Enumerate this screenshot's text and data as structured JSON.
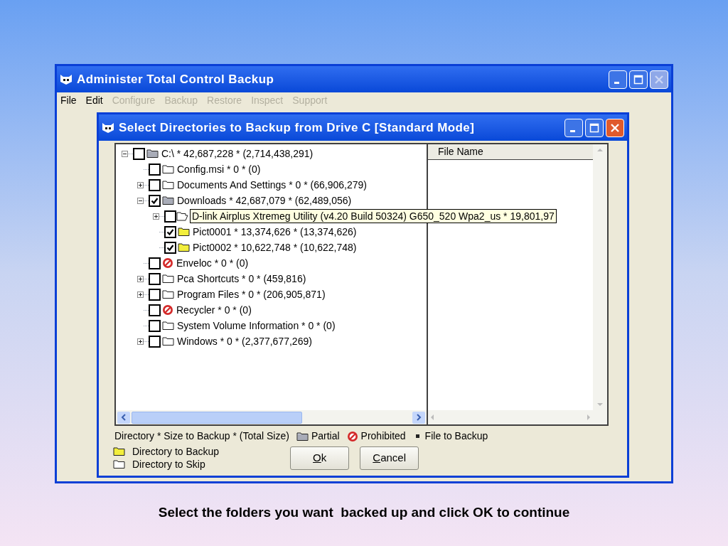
{
  "slide": {
    "caption": "Select the folders you want  backed up and click OK to continue"
  },
  "window": {
    "title": "Administer Total Control Backup",
    "controls": [
      {
        "kind": "minimize",
        "disabled": false
      },
      {
        "kind": "maximize",
        "disabled": false
      },
      {
        "kind": "close",
        "disabled": true
      }
    ]
  },
  "menu": [
    {
      "label": "File",
      "disabled": false
    },
    {
      "label": "Edit",
      "disabled": false
    },
    {
      "label": "Configure",
      "disabled": true
    },
    {
      "label": "Backup",
      "disabled": true
    },
    {
      "label": "Restore",
      "disabled": true
    },
    {
      "label": "Inspect",
      "disabled": true
    },
    {
      "label": "Support",
      "disabled": true
    }
  ],
  "dialog": {
    "title": "Select Directories to Backup from Drive C [Standard Mode]",
    "controls": [
      {
        "kind": "minimize",
        "disabled": false
      },
      {
        "kind": "maximize",
        "disabled": false
      },
      {
        "kind": "close",
        "disabled": false
      }
    ],
    "tree": [
      {
        "label": "C:\\ * 42,687,228 * (2,714,438,291)",
        "checked": false,
        "kind": "partial",
        "expanded": true,
        "hovered": false,
        "children": [
          {
            "label": "Config.msi * 0 * (0)",
            "checked": false,
            "kind": "skip",
            "hovered": false
          },
          {
            "label": "Documents And Settings * 0 * (66,906,279)",
            "checked": false,
            "kind": "skip",
            "expanded": false,
            "hovered": false
          },
          {
            "label": "Downloads * 42,687,079 * (62,489,056)",
            "checked": true,
            "kind": "partial",
            "expanded": true,
            "hovered": false,
            "children": [
              {
                "label": "D-link Airplus Xtremeg Utility (v4.20 Build 50324) G650_520 Wpa2_us * 19,801,97",
                "checked": false,
                "kind": "open",
                "expanded": false,
                "hovered": true
              },
              {
                "label": "Pict0001 * 13,374,626 * (13,374,626)",
                "checked": true,
                "kind": "backup",
                "hovered": false
              },
              {
                "label": "Pict0002 * 10,622,748 * (10,622,748)",
                "checked": true,
                "kind": "backup",
                "hovered": false
              }
            ]
          },
          {
            "label": "Enveloc * 0 * (0)",
            "checked": false,
            "kind": "prohibited",
            "hovered": false
          },
          {
            "label": "Pca Shortcuts * 0 * (459,816)",
            "checked": false,
            "kind": "skip",
            "expanded": false,
            "hovered": false
          },
          {
            "label": "Program Files * 0 * (206,905,871)",
            "checked": false,
            "kind": "skip",
            "expanded": false,
            "hovered": false
          },
          {
            "label": "Recycler * 0 * (0)",
            "checked": false,
            "kind": "prohibited",
            "hovered": false
          },
          {
            "label": "System Volume Information * 0 * (0)",
            "checked": false,
            "kind": "skip",
            "hovered": false
          },
          {
            "label": "Windows * 0 * (2,377,677,269)",
            "checked": false,
            "kind": "skip",
            "expanded": false,
            "hovered": false
          }
        ]
      }
    ],
    "file_list": {
      "columns": [
        "File Name"
      ]
    },
    "legend": {
      "text": "Directory * Size to Backup * (Total Size)",
      "items": [
        {
          "kind": "partial",
          "label": "Partial"
        },
        {
          "kind": "prohibited",
          "label": "Prohibited"
        },
        {
          "kind": "file",
          "label": "File to Backup"
        }
      ],
      "folders": [
        {
          "kind": "backup",
          "label": "Directory to Backup"
        },
        {
          "kind": "skip",
          "label": "Directory to Skip"
        }
      ]
    },
    "buttons": [
      {
        "label": "Ok"
      },
      {
        "label": "Cancel"
      }
    ]
  }
}
